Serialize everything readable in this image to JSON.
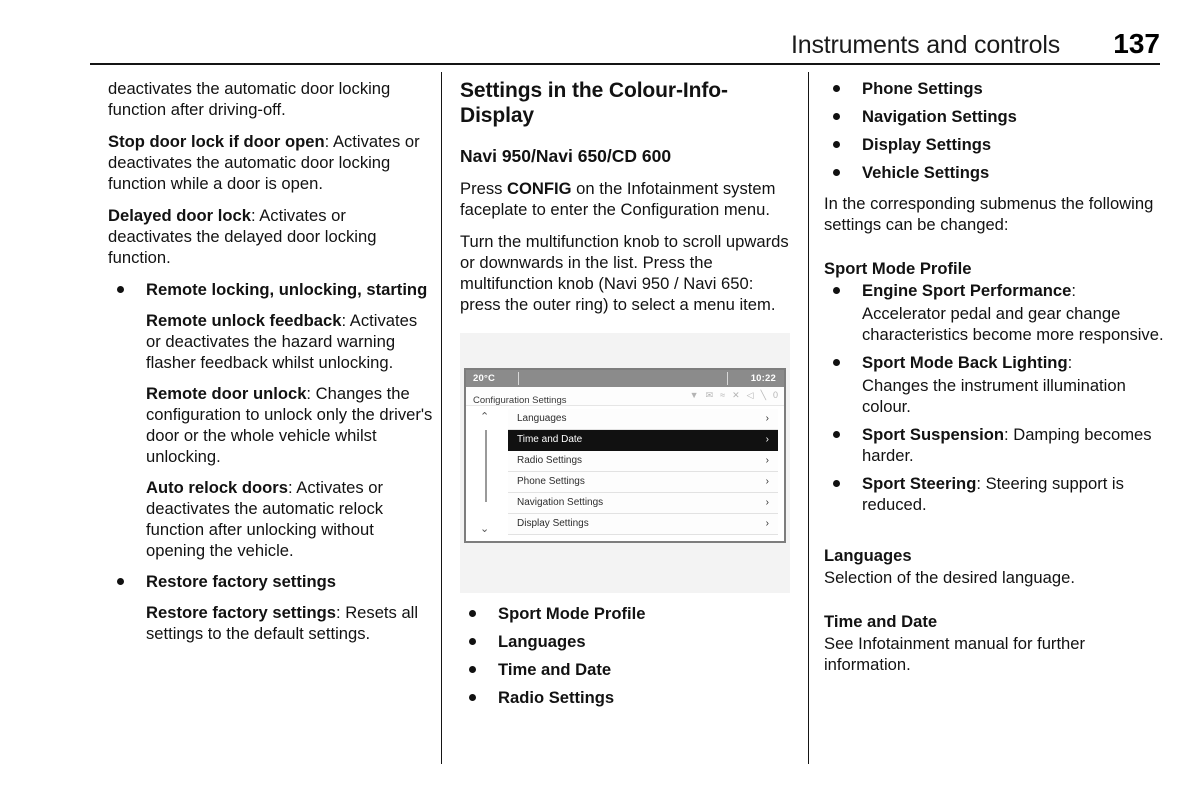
{
  "header": {
    "title": "Instruments and controls",
    "page_number": "137"
  },
  "column_left": {
    "continued_paragraph": "deactivates the automatic door locking function after driving-off.",
    "entries": [
      {
        "lead": "Stop door lock if door open",
        "body": ": Activates or deactivates the automatic door locking function while a door is open."
      },
      {
        "lead": "Delayed door lock",
        "body": ": Activates or deactivates the delayed door locking function."
      }
    ],
    "bullet_remote": "Remote locking, unlocking, starting",
    "remote_entries": [
      {
        "lead": "Remote unlock feedback",
        "body": ": Activates or deactivates the hazard warning flasher feedback whilst unlocking."
      },
      {
        "lead": "Remote door unlock",
        "body": ": Changes the configuration to unlock only the driver's door or the whole vehicle whilst unlocking."
      },
      {
        "lead": "Auto relock doors",
        "body": ": Activates or deactivates the automatic relock function after unlocking without opening the vehicle."
      }
    ],
    "bullet_restore": "Restore factory settings",
    "restore_entry": {
      "lead": "Restore factory settings",
      "body": ": Resets all settings to the default settings."
    }
  },
  "column_mid": {
    "section_title": "Settings in the Colour-Info-Display",
    "sub_title": "Navi 950/Navi 650/CD 600",
    "paragraph_1_pre": "Press ",
    "paragraph_1_bold": "CONFIG",
    "paragraph_1_post": " on the Infotainment system faceplate to enter the Configuration menu.",
    "paragraph_2": "Turn the multifunction knob to scroll upwards or downwards in the list. Press the multifunction knob (Navi 950 / Navi 650: press the outer ring) to select a menu item.",
    "figure": {
      "status_temperature": "20°C",
      "status_time": "10:22",
      "screen_title": "Configuration Settings",
      "indicator_icons": [
        "wifi-icon",
        "message-icon",
        "equalizer-icon",
        "shuffle-icon",
        "mute-icon",
        "phone-icon",
        "zero-icon"
      ],
      "indicator_glyphs": [
        "▼",
        "✉",
        "≈",
        "✕",
        "◁",
        "╲",
        "0"
      ],
      "scroll_up_glyph": "⌃",
      "scroll_down_glyph": "⌄",
      "menu_items": [
        {
          "label": "Languages",
          "selected": false
        },
        {
          "label": "Time and Date",
          "selected": true
        },
        {
          "label": "Radio Settings",
          "selected": false
        },
        {
          "label": "Phone Settings",
          "selected": false
        },
        {
          "label": "Navigation Settings",
          "selected": false
        },
        {
          "label": "Display Settings",
          "selected": false
        }
      ],
      "chevron_glyph": "›"
    },
    "menu_bullets": [
      "Sport Mode Profile",
      "Languages",
      "Time and Date",
      "Radio Settings"
    ]
  },
  "column_right": {
    "menu_bullets": [
      "Phone Settings",
      "Navigation Settings",
      "Display Settings",
      "Vehicle Settings"
    ],
    "intro_paragraph": "In the corresponding submenus the following settings can be changed:",
    "sport_mode_heading": "Sport Mode Profile",
    "sport_mode_entries": [
      {
        "lead": "Engine Sport Performance",
        "lead_suffix": ":",
        "body": "Accelerator pedal and gear change characteristics become more responsive.",
        "body_inline": false
      },
      {
        "lead": "Sport Mode Back Lighting",
        "lead_suffix": ":",
        "body": "Changes the instrument illumination colour.",
        "body_inline": false
      },
      {
        "lead": "Sport Suspension",
        "lead_suffix": ":",
        "body": " Damping becomes harder.",
        "body_inline": true
      },
      {
        "lead": "Sport Steering",
        "lead_suffix": ":",
        "body": " Steering support is reduced.",
        "body_inline": true
      }
    ],
    "languages_heading": "Languages",
    "languages_body": "Selection of the desired language.",
    "time_date_heading": "Time and Date",
    "time_date_body": "See Infotainment manual for further information."
  }
}
